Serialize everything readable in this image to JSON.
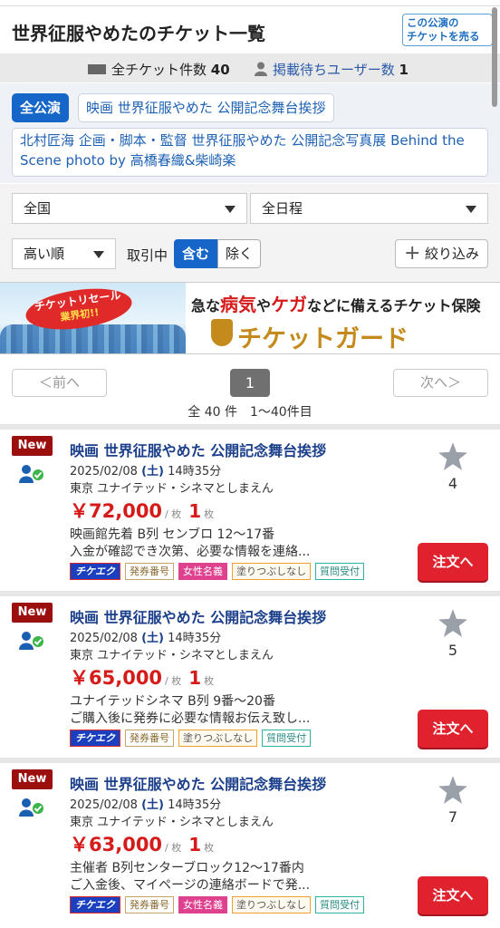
{
  "header": {
    "title": "世界征服やめたのチケット一覧",
    "sell_button_line1": "この公演の",
    "sell_button_line2": "チケットを売る"
  },
  "stats": {
    "total_label": "全チケット件数",
    "total_count": "40",
    "waiting_label": "掲載待ちユーザー数",
    "waiting_count": "1"
  },
  "filter_tags": [
    {
      "label": "全公演",
      "active": true
    },
    {
      "label": "映画 世界征服やめた 公開記念舞台挨拶",
      "active": false
    },
    {
      "label": "北村匠海 企画・脚本・監督 世界征服やめた 公開記念写真展 Behind the Scene photo by 高橋春織&柴崎楽",
      "active": false
    }
  ],
  "selects": {
    "region": "全国",
    "schedule": "全日程",
    "sort": "高い順",
    "trading_label": "取引中",
    "include_label": "含む",
    "exclude_label": "除く",
    "narrow_label": "絞り込み"
  },
  "banner": {
    "badge_line1": "チケットリセール",
    "badge_line2": "業界初!!",
    "text_pre": "急な",
    "text_sick": "病気",
    "text_ya": "や",
    "text_injury": "ケガ",
    "text_post": "などに備えるチケット保険",
    "brand": "チケットガード"
  },
  "pager": {
    "prev": "＜前へ",
    "current": "1",
    "next": "次へ＞",
    "count_text": "全 40 件　1〜40件目"
  },
  "tickets": [
    {
      "badge": "New",
      "title": "映画 世界征服やめた 公開記念舞台挨拶",
      "date": "2025/02/08",
      "weekday": "(土)",
      "time": "14時35分",
      "venue": "東京 ユナイテッド・シネマとしまえん",
      "price": "￥72,000",
      "price_unit": "/ 枚",
      "qty": "1",
      "qty_unit": "枚",
      "desc1": "映画館先着 B列 センブロ 12〜17番",
      "desc2": "入金が確認でき次第、必要な情報を連絡...",
      "tags": [
        "チケエク",
        "発券番号",
        "女性名義",
        "塗りつぶしなし",
        "質問受付"
      ],
      "favorites": "4",
      "order_label": "注文へ"
    },
    {
      "badge": "New",
      "title": "映画 世界征服やめた 公開記念舞台挨拶",
      "date": "2025/02/08",
      "weekday": "(土)",
      "time": "14時35分",
      "venue": "東京 ユナイテッド・シネマとしまえん",
      "price": "￥65,000",
      "price_unit": "/ 枚",
      "qty": "1",
      "qty_unit": "枚",
      "desc1": "ユナイテッドシネマ B列 9番〜20番",
      "desc2": "ご購入後に発券に必要な情報お伝え致し...",
      "tags": [
        "チケエク",
        "発券番号",
        "塗りつぶしなし",
        "質問受付"
      ],
      "favorites": "5",
      "order_label": "注文へ"
    },
    {
      "badge": "New",
      "title": "映画 世界征服やめた 公開記念舞台挨拶",
      "date": "2025/02/08",
      "weekday": "(土)",
      "time": "14時35分",
      "venue": "東京 ユナイテッド・シネマとしまえん",
      "price": "￥63,000",
      "price_unit": "/ 枚",
      "qty": "1",
      "qty_unit": "枚",
      "desc1": "主催者 B列センターブロック12〜17番内",
      "desc2": "ご入金後、マイページの連絡ボードで発...",
      "tags": [
        "チケエク",
        "発券番号",
        "女性名義",
        "塗りつぶしなし",
        "質問受付"
      ],
      "favorites": "7",
      "order_label": "注文へ"
    }
  ],
  "colors": {
    "brand_blue": "#1566c8",
    "price_red": "#d61b1b",
    "order_red": "#e0222e",
    "new_badge": "#9c0f0f",
    "title_navy": "#1b3f8a"
  }
}
